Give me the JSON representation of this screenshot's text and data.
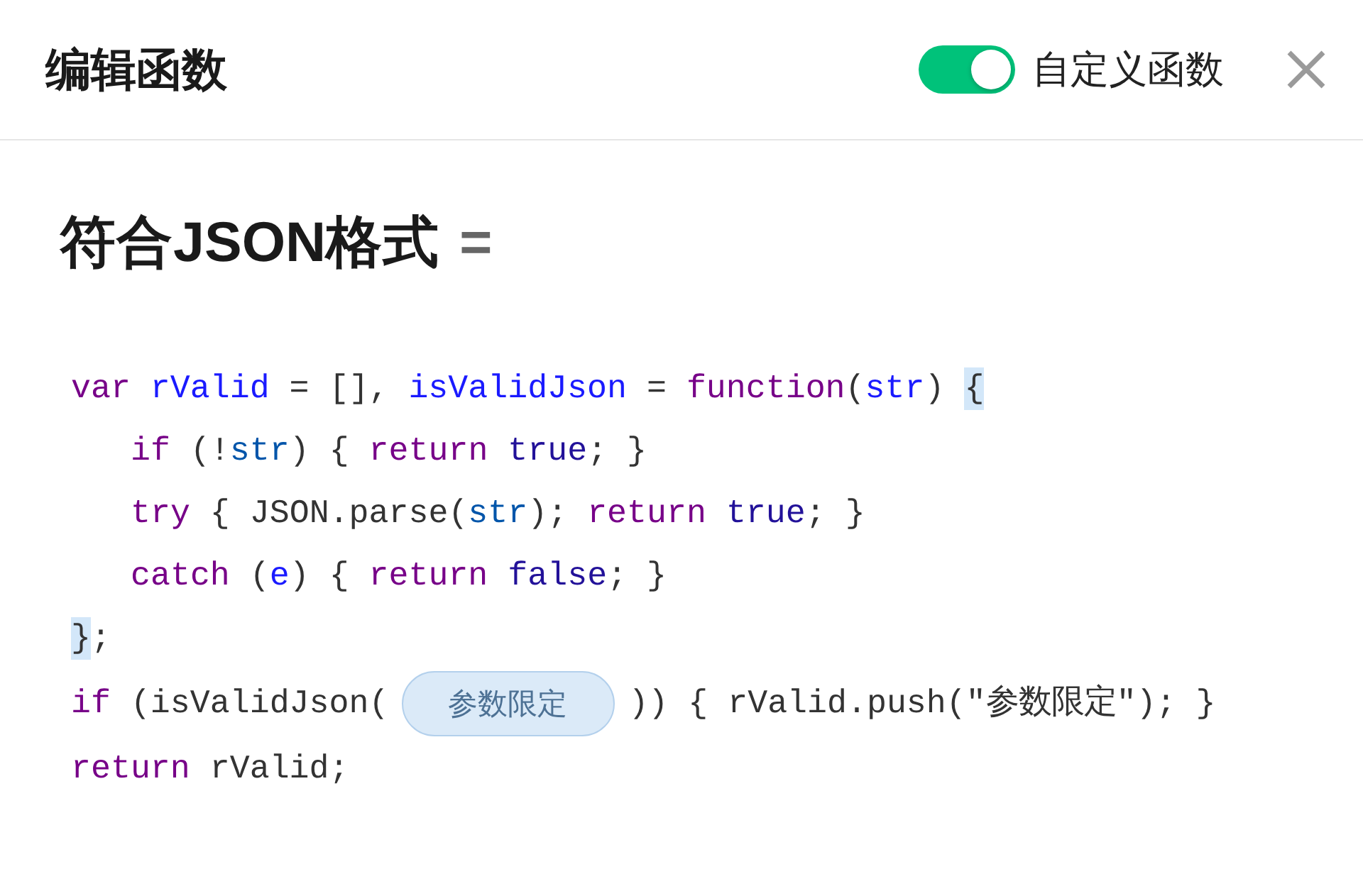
{
  "header": {
    "title": "编辑函数",
    "custom_toggle": {
      "label": "自定义函数",
      "on": true
    }
  },
  "section": {
    "title": "符合JSON格式",
    "operator": "="
  },
  "code": {
    "lines": [
      {
        "tokens": [
          {
            "text": "var ",
            "kind": "keyword"
          },
          {
            "text": "rValid",
            "kind": "def"
          },
          {
            "text": " = [], ",
            "kind": "plain"
          },
          {
            "text": "isValidJson",
            "kind": "def"
          },
          {
            "text": " = ",
            "kind": "plain"
          },
          {
            "text": "function",
            "kind": "keyword"
          },
          {
            "text": "(",
            "kind": "plain"
          },
          {
            "text": "str",
            "kind": "def"
          },
          {
            "text": ") ",
            "kind": "plain"
          },
          {
            "text": "{",
            "kind": "matched-bracket"
          }
        ],
        "children": [
          {
            "tokens": [
              {
                "text": "if ",
                "kind": "keyword"
              },
              {
                "text": "(!",
                "kind": "plain"
              },
              {
                "text": "str",
                "kind": "variable"
              },
              {
                "text": ") { ",
                "kind": "plain"
              },
              {
                "text": "return ",
                "kind": "keyword"
              },
              {
                "text": "true",
                "kind": "atom"
              },
              {
                "text": "; }",
                "kind": "plain"
              }
            ]
          },
          {
            "tokens": [
              {
                "text": "try ",
                "kind": "keyword"
              },
              {
                "text": "{ JSON.parse(",
                "kind": "plain"
              },
              {
                "text": "str",
                "kind": "variable"
              },
              {
                "text": "); ",
                "kind": "plain"
              },
              {
                "text": "return ",
                "kind": "keyword"
              },
              {
                "text": "true",
                "kind": "atom"
              },
              {
                "text": "; }",
                "kind": "plain"
              }
            ]
          },
          {
            "tokens": [
              {
                "text": "catch ",
                "kind": "keyword"
              },
              {
                "text": "(",
                "kind": "plain"
              },
              {
                "text": "e",
                "kind": "def"
              },
              {
                "text": ") { ",
                "kind": "plain"
              },
              {
                "text": "return ",
                "kind": "keyword"
              },
              {
                "text": "false",
                "kind": "atom"
              },
              {
                "text": "; }",
                "kind": "plain"
              }
            ]
          }
        ]
      },
      {
        "tokens": [
          {
            "text": "}",
            "kind": "matched-bracket"
          },
          {
            "text": ";",
            "kind": "plain"
          }
        ]
      },
      {
        "tokens": [
          {
            "text": "if ",
            "kind": "keyword"
          },
          {
            "text": "(isValidJson(",
            "kind": "plain"
          },
          {
            "text": "参数限定",
            "kind": "param"
          },
          {
            "text": ")) { rValid.push(\"参数限定\"); }",
            "kind": "plain"
          }
        ]
      },
      {
        "tokens": [
          {
            "text": "return ",
            "kind": "keyword"
          },
          {
            "text": "rValid;",
            "kind": "plain"
          }
        ]
      }
    ]
  }
}
